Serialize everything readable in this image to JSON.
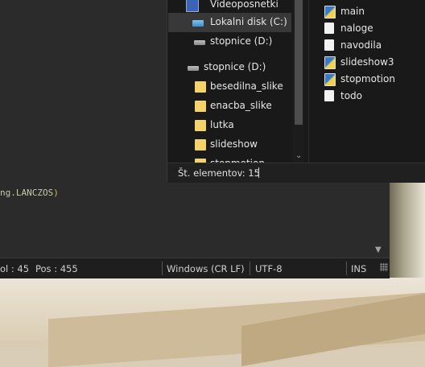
{
  "editor": {
    "code_fragment": "ng.LANCZOS",
    "code_paren": ")"
  },
  "statusbar": {
    "col": "ol : 45",
    "pos": "Pos : 455",
    "eol": "Windows (CR LF)",
    "encoding": "UTF-8",
    "mode": "INS"
  },
  "explorer": {
    "nav": [
      {
        "label": "Videoposnetki",
        "icon": "videos-icon"
      },
      {
        "label": "Lokalni disk (C:)",
        "icon": "drive-c-icon",
        "selected": true
      },
      {
        "label": "stopnice (D:)",
        "icon": "drive-icon"
      },
      {
        "label": "stopnice (D:)",
        "icon": "drive-icon"
      },
      {
        "label": "besedilna_slike",
        "icon": "folder-icon"
      },
      {
        "label": "enacba_slike",
        "icon": "folder-icon"
      },
      {
        "label": "lutka",
        "icon": "folder-icon"
      },
      {
        "label": "slideshow",
        "icon": "folder-icon"
      },
      {
        "label": "stopmotion",
        "icon": "folder-icon"
      }
    ],
    "files": [
      {
        "label": "main",
        "icon": "python-file-icon"
      },
      {
        "label": "naloge",
        "icon": "text-file-icon"
      },
      {
        "label": "navodila",
        "icon": "text-file-icon"
      },
      {
        "label": "slideshow3",
        "icon": "python-file-icon"
      },
      {
        "label": "stopmotion",
        "icon": "python-file-icon"
      },
      {
        "label": "todo",
        "icon": "text-file-icon"
      }
    ],
    "status": "Št. elementov: 15"
  }
}
